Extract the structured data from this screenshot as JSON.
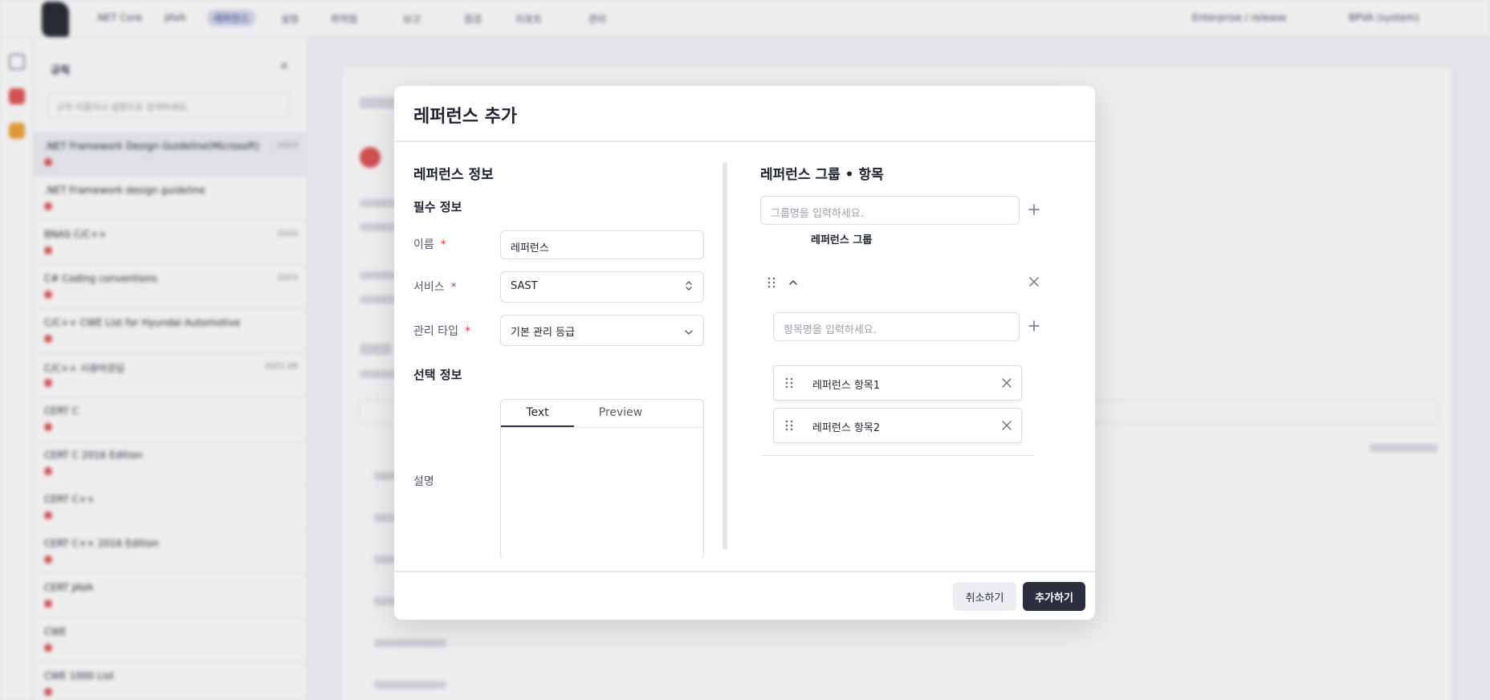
{
  "background": {
    "nav": [
      ".NET Core",
      "JAVA",
      "레퍼런스",
      "설정",
      "취약점",
      "보고",
      "점검",
      "리포트",
      "관리"
    ],
    "nav_active_index": 2,
    "top_right": [
      "Enterprise / release",
      "BPVA (system)"
    ],
    "sidebar": {
      "title": "규칙",
      "search_placeholder": "규칙 이름이나 설명으로 검색하세요.",
      "items": [
        {
          "title": ".NET Framework Design Guideline(Microsoft)",
          "version": "2023"
        },
        {
          "title": ".NET Framework design guideline",
          "version": ""
        },
        {
          "title": "BNAS C/C++",
          "version": "2020"
        },
        {
          "title": "C# Coding conventions",
          "version": "2023"
        },
        {
          "title": "C/C++ CWE List for Hyundai Automotive",
          "version": ""
        },
        {
          "title": "C/C++ 시큐어코딩",
          "version": "2021.06"
        },
        {
          "title": "CERT C",
          "version": ""
        },
        {
          "title": "CERT C 2016 Edition",
          "version": ""
        },
        {
          "title": "CERT C++",
          "version": ""
        },
        {
          "title": "CERT C++ 2016 Edition",
          "version": ""
        },
        {
          "title": "CERT JAVA",
          "version": ""
        },
        {
          "title": "CWE",
          "version": ""
        },
        {
          "title": "CWE 1000 List",
          "version": ""
        }
      ]
    }
  },
  "modal": {
    "title": "레퍼런스 추가",
    "left": {
      "section_title": "레퍼런스 정보",
      "required_title": "필수 정보",
      "name_label": "이름",
      "name_value": "레퍼런스",
      "service_label": "서비스",
      "service_value": "SAST",
      "type_label": "관리 타입",
      "type_value": "기본 관리 등급",
      "required_mark": "*",
      "optional_title": "선택 정보",
      "description_label": "설명",
      "tab_text": "Text",
      "tab_preview": "Preview"
    },
    "right": {
      "section_title": "레퍼런스 그룹 • 항목",
      "group_placeholder": "그룹명을 입력하세요.",
      "group_name": "레퍼런스 그룹",
      "item_placeholder": "항목명을 입력하세요.",
      "items": [
        "레퍼런스 항목1",
        "레퍼런스 항목2"
      ]
    },
    "footer": {
      "cancel_label": "취소하기",
      "add_label": "추가하기"
    }
  },
  "icons": {
    "plus": "plus-icon",
    "drag": "drag-handle-icon",
    "close": "close-icon",
    "chevron_up": "chevron-up-icon",
    "chevron_down": "chevron-down-icon",
    "updown": "updown-icon"
  },
  "colors": {
    "primary_button": "#2a2e3e",
    "required": "#e03b3b",
    "status_red": "#e05555"
  }
}
